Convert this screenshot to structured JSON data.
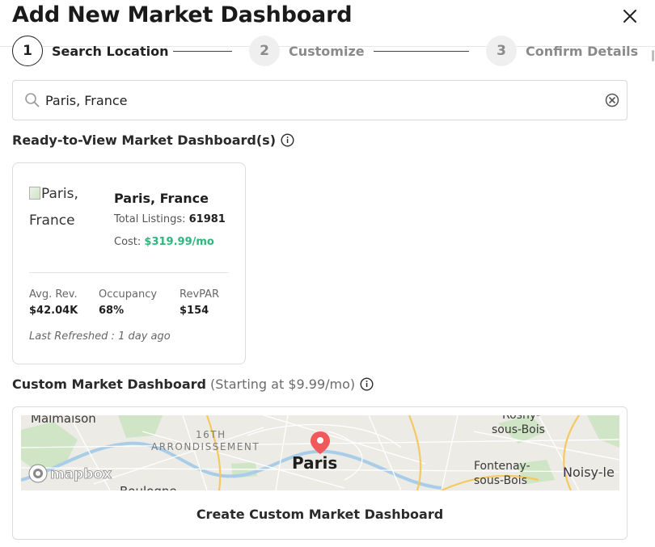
{
  "header": {
    "title": "Add New Market Dashboard"
  },
  "stepper": {
    "steps": [
      {
        "number": "1",
        "label": "Search Location"
      },
      {
        "number": "2",
        "label": "Customize"
      },
      {
        "number": "3",
        "label": "Confirm Details"
      }
    ]
  },
  "search": {
    "value": "Paris, France",
    "placeholder": ""
  },
  "ready_section": {
    "heading": "Ready-to-View Market Dashboard(s)"
  },
  "market_card": {
    "image_alt": "Paris, France",
    "name": "Paris, France",
    "total_listings_label": "Total Listings:",
    "total_listings_value": "61981",
    "cost_label": "Cost:",
    "cost_value": "$319.99/mo",
    "metrics": [
      {
        "label": "Avg. Rev.",
        "value": "$42.04K"
      },
      {
        "label": "Occupancy",
        "value": "68%"
      },
      {
        "label": "RevPAR",
        "value": "$154"
      }
    ],
    "last_refreshed": "Last Refreshed : 1 day ago"
  },
  "custom_section": {
    "heading": "Custom Market Dashboard",
    "subheading": "(Starting at $9.99/mo)"
  },
  "map": {
    "labels": {
      "malmaison": "Malmaison",
      "arr_16th": "16TH",
      "arrondissement": "ARRONDISSEMENT",
      "paris": "Paris",
      "rosny": "Rosny-",
      "sous_bois_1": "sous-Bois",
      "fontenay": "Fontenay-",
      "sous_bois_2": "sous-Bois",
      "noisy": "Noisy-le",
      "boulogne": "Boulogne",
      "attribution": "mapbox"
    },
    "colors": {
      "land": "#ecebe6",
      "park": "#cfe5c6",
      "water": "#a9cde8",
      "major_road": "#f6c85f",
      "marker": "#f05a5a"
    }
  },
  "custom_card": {
    "button_label": "Create Custom Market Dashboard"
  },
  "colors": {
    "accent_green": "#2eb67d",
    "text_dark": "#1f1f1f",
    "border": "#dcdcdc"
  }
}
